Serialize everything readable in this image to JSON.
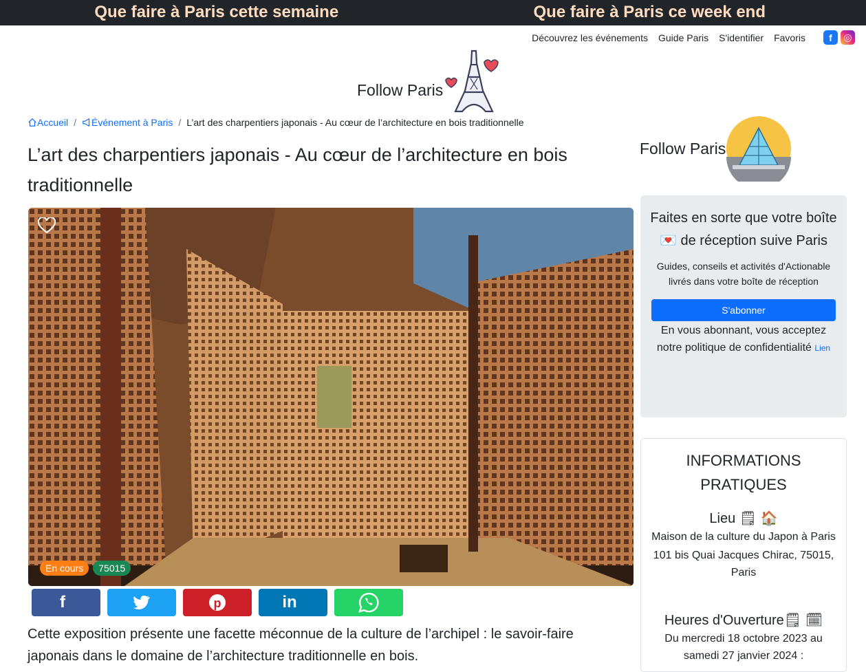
{
  "topbar": {
    "week": "Que faire à Paris cette semaine",
    "weekend": "Que faire à Paris ce week end"
  },
  "nav": {
    "items": [
      "Découvrez les événements",
      "Guide Paris",
      "S'identifier",
      "Favoris"
    ]
  },
  "brand": {
    "name": "Follow Paris"
  },
  "breadcrumb": {
    "home": "Accueil",
    "events": "Événement à Paris",
    "current": "L’art des charpentiers japonais - Au cœur de l’architecture en bois traditionnelle"
  },
  "article": {
    "title": "L’art des charpentiers japonais - Au cœur de l’architecture en bois traditionnelle",
    "status": "En cours",
    "postcode": "75015",
    "intro": "Cette exposition présente une facette méconnue de la culture de l’archipel : le savoir-faire japonais dans le domaine de l’architecture traditionnelle en bois."
  },
  "share": {
    "colors": [
      "#3b5998",
      "#1da1f2",
      "#cb2027",
      "#0077b5",
      "#25d366"
    ]
  },
  "newsletter": {
    "title_a": "Faites en sorte que votre boîte",
    "title_b": "de réception suive Paris",
    "desc": "Guides, conseils et activités d'Actionable livrés dans votre boîte de réception",
    "button": "S'abonner",
    "terms": "En vous abonnant, vous acceptez notre politique de confidentialité",
    "link": "Lien"
  },
  "info": {
    "heading": "INFORMATIONS PRATIQUES",
    "lieu_label": "Lieu",
    "lieu_name": "Maison de la culture du Japon à Paris",
    "lieu_address": "101 bis Quai Jacques Chirac, 75015, Paris",
    "hours_label": "Heures d'Ouverture",
    "hours_value": "Du mercredi 18 octobre 2023 au samedi 27 janvier 2024 :"
  }
}
